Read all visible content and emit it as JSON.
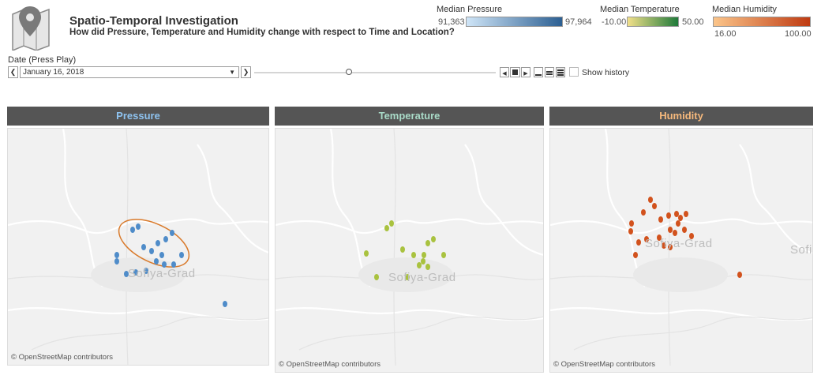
{
  "header": {
    "title": "Spatio-Temporal Investigation",
    "subtitle": "How did Pressure, Temperature and Humidity change with respect to Time and Location?"
  },
  "legends": {
    "pressure": {
      "title": "Median Pressure",
      "min": "91,363",
      "max": "97,964",
      "colors": [
        "#cfe5f7",
        "#2c5f92"
      ]
    },
    "temperature": {
      "title": "Median Temperature",
      "min": "-10.00",
      "max": "50.00",
      "colors": [
        "#f2e08a",
        "#1f7a3a"
      ]
    },
    "humidity": {
      "title": "Median Humidity",
      "min": "16.00",
      "max": "100.00",
      "colors": [
        "#fbc58a",
        "#bf3b12"
      ]
    }
  },
  "controls": {
    "date_label": "Date (Press Play)",
    "date_value": "January 16, 2018",
    "show_history_label": "Show history",
    "show_history_checked": false
  },
  "panels": [
    {
      "title": "Pressure",
      "title_color": "#8ec3f0",
      "marker_color": "#4f8cc9",
      "city": "Sofiya-Grad",
      "credit": "© OpenStreetMap contributors"
    },
    {
      "title": "Temperature",
      "title_color": "#a9dbc8",
      "marker_color": "#a9c23f",
      "city": "Sofiya-Grad",
      "credit": "© OpenStreetMap contributors"
    },
    {
      "title": "Humidity",
      "title_color": "#f6b97c",
      "marker_color": "#d2521d",
      "city": "Sofiya-Grad",
      "credit": "© OpenStreetMap contributors",
      "extra_city": "Sofi"
    }
  ],
  "icons": {
    "map_pin": "map-pin-icon",
    "prev": "chevron-left-icon",
    "next": "chevron-right-icon",
    "dropdown": "chevron-down-icon",
    "play_back": "play-back-icon",
    "stop": "stop-icon",
    "play_forward": "play-forward-icon",
    "speed": "speed-icon"
  },
  "annotation_color": "#d97a2b"
}
